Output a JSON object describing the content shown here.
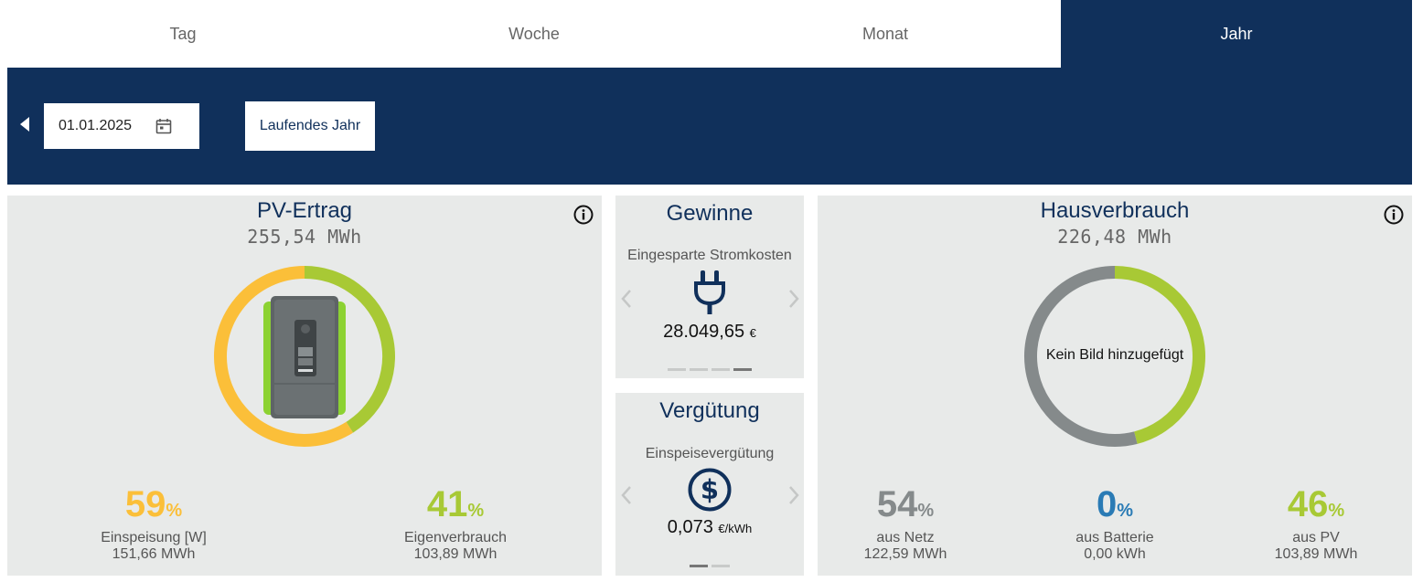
{
  "tabs": [
    {
      "label": "Tag",
      "active": false
    },
    {
      "label": "Woche",
      "active": false
    },
    {
      "label": "Monat",
      "active": false
    },
    {
      "label": "Jahr",
      "active": true
    }
  ],
  "datebar": {
    "date_value": "01.01.2025",
    "current_year_button": "Laufendes Jahr"
  },
  "colors": {
    "navy": "#10305b",
    "yellow": "#fbbf39",
    "green": "#a8c935",
    "gray": "#858a8b",
    "blue": "#2a7bb5",
    "panel_bg": "#e8eae9"
  },
  "pv": {
    "title": "PV-Ertrag",
    "total": "255,54 MWh",
    "feed_in": {
      "percent": "59",
      "unit": "%",
      "label": "Einspeisung [W]",
      "value": "151,66 MWh",
      "fraction": 0.59
    },
    "self_use": {
      "percent": "41",
      "unit": "%",
      "label": "Eigenverbrauch",
      "value": "103,89 MWh",
      "fraction": 0.41
    }
  },
  "gewinne": {
    "title": "Gewinne",
    "subtitle": "Eingesparte Stromkosten",
    "icon": "plug-icon",
    "amount": "28.049,65",
    "unit": "€",
    "pages": 4,
    "active_page": 4
  },
  "verguetung": {
    "title": "Vergütung",
    "subtitle": "Einspeisevergütung",
    "icon": "dollar-icon",
    "amount": "0,073",
    "unit": "€/kWh",
    "pages": 2,
    "active_page": 1
  },
  "haus": {
    "title": "Hausverbrauch",
    "total": "226,48 MWh",
    "center_text": "Kein Bild hinzugefügt",
    "netz": {
      "percent": "54",
      "unit": "%",
      "label": "aus Netz",
      "value": "122,59 MWh",
      "fraction": 0.54
    },
    "batterie": {
      "percent": "0",
      "unit": "%",
      "label": "aus Batterie",
      "value": "0,00 kWh",
      "fraction": 0
    },
    "pv": {
      "percent": "46",
      "unit": "%",
      "label": "aus PV",
      "value": "103,89 MWh",
      "fraction": 0.46
    }
  }
}
